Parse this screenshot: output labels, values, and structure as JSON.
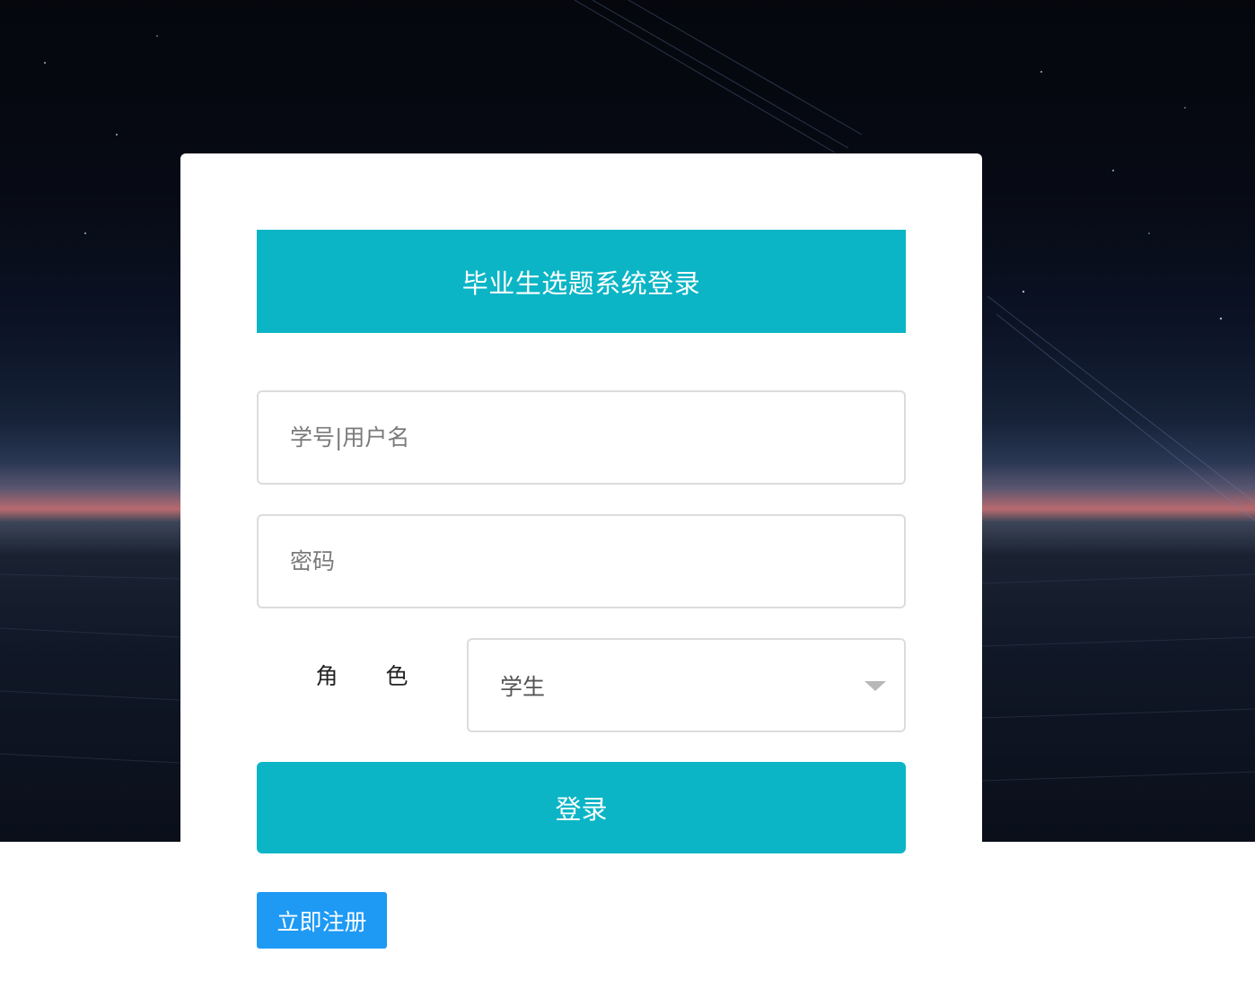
{
  "page": {
    "title": "毕业生选题系统登录"
  },
  "form": {
    "username_placeholder": "学号|用户名",
    "password_placeholder": "密码",
    "role_label_1": "角",
    "role_label_2": "色",
    "role_selected": "学生",
    "login_label": "登录",
    "register_label": "立即注册"
  },
  "colors": {
    "accent": "#0bb5c6",
    "register": "#1e9af5"
  },
  "icons": {
    "role_dropdown": "caret-down-icon"
  }
}
